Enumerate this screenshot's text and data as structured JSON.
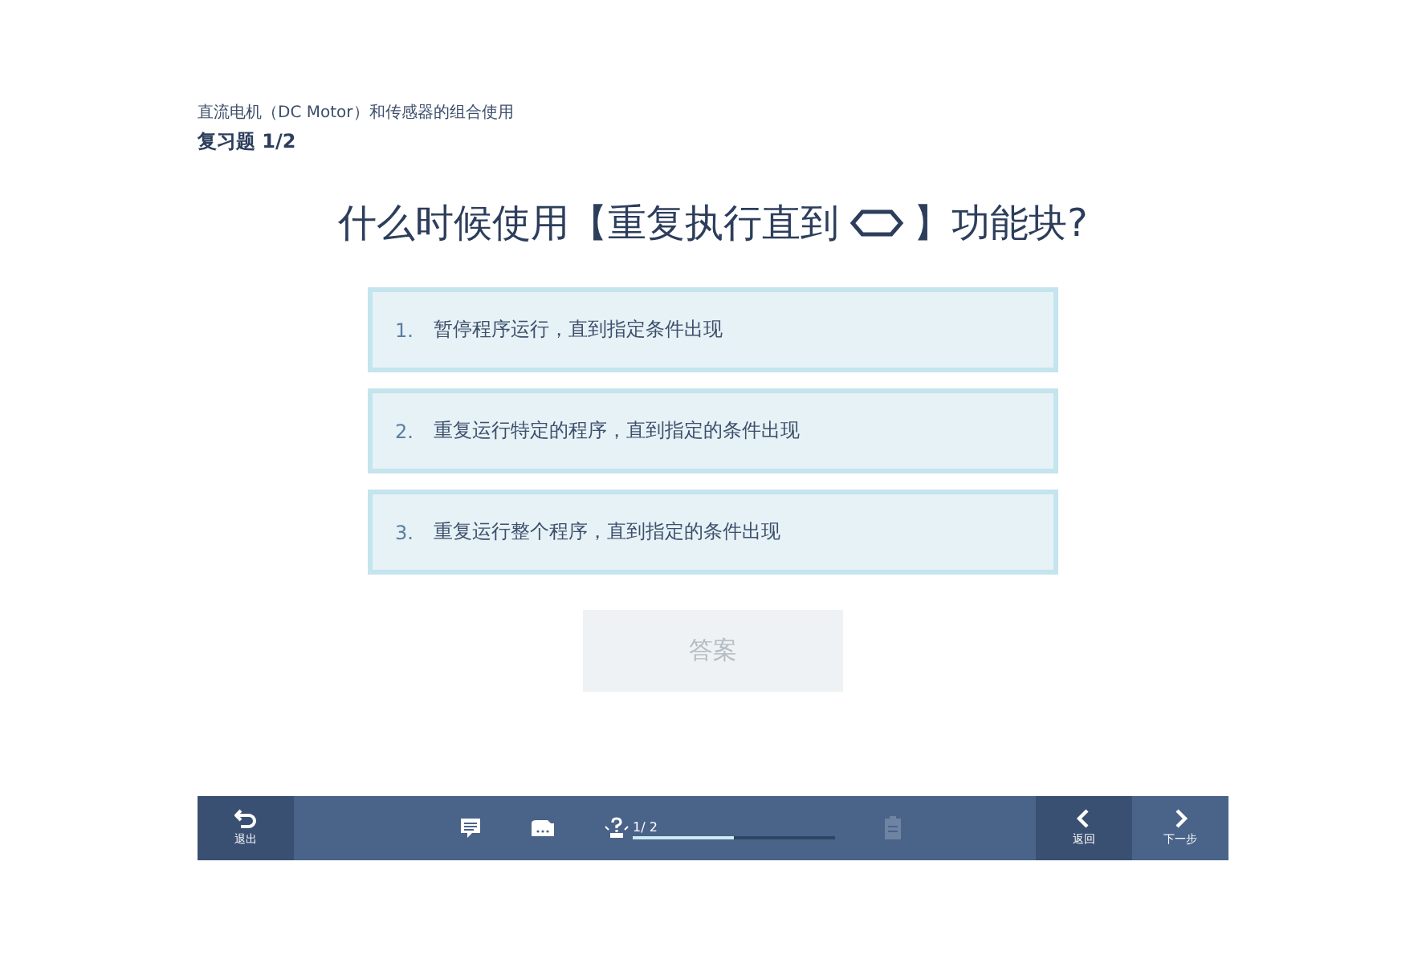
{
  "header": {
    "course": "直流电机（DC Motor）和传感器的组合使用",
    "title": "复习题 1/2"
  },
  "question": {
    "before": "什么时候使用【重复执行直到",
    "after": "】功能块?"
  },
  "options": [
    {
      "number": "1.",
      "text": "暂停程序运行，直到指定条件出现",
      "selected": false
    },
    {
      "number": "2.",
      "text": "重复运行特定的程序，直到指定的条件出现",
      "selected": false
    },
    {
      "number": "3.",
      "text": "重复运行整个程序，直到指定的条件出现",
      "selected": false
    }
  ],
  "answer_button": {
    "label": "答案",
    "disabled": true
  },
  "toolbar": {
    "exit": "退出",
    "progress_text": "1/ 2",
    "level": 0.5,
    "clipboard_disabled": true,
    "back": "返回",
    "next": "下一步"
  }
}
